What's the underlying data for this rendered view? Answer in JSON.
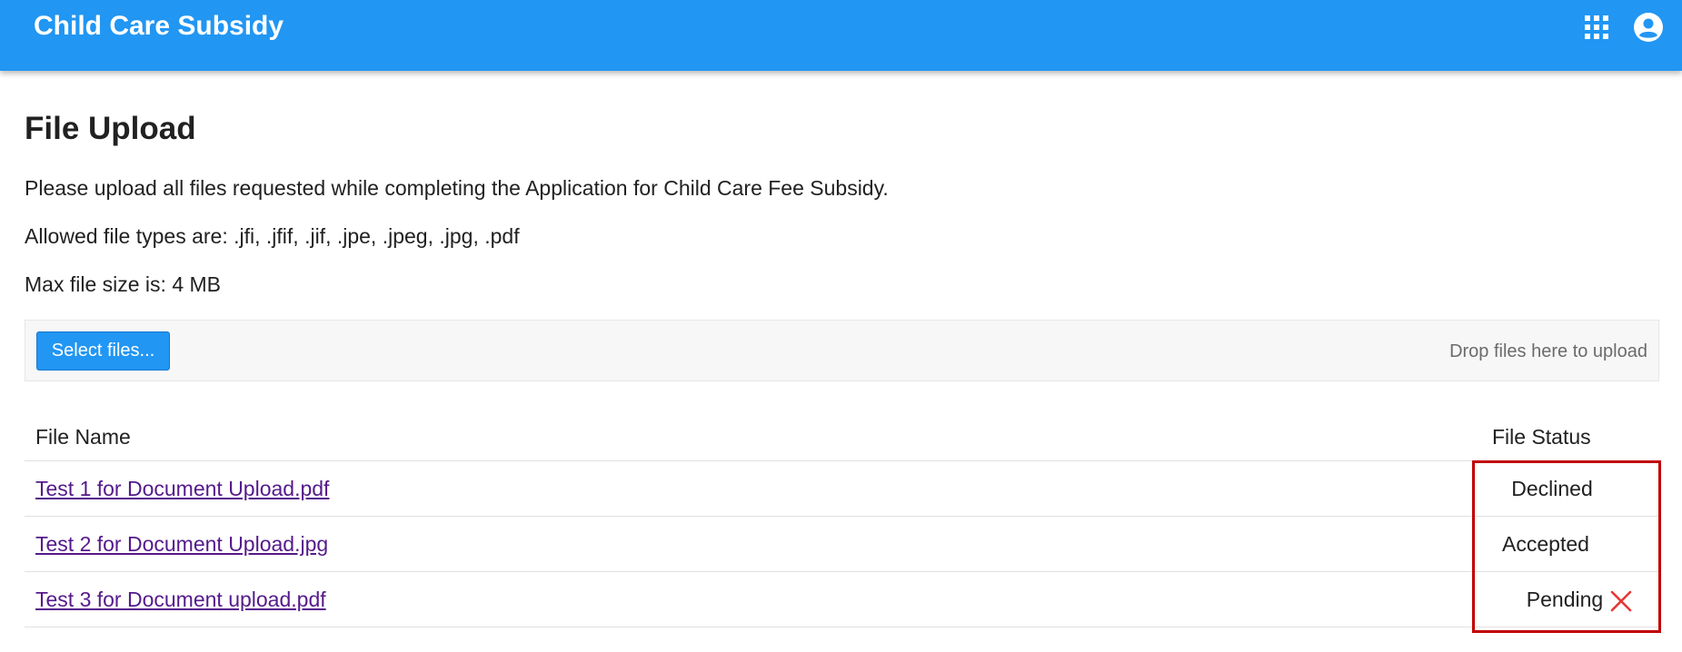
{
  "app": {
    "title": "Child Care Subsidy",
    "brand_color": "#2196f3",
    "icons": [
      "apps-grid-icon",
      "account-circle-icon"
    ]
  },
  "page": {
    "title": "File Upload",
    "instructions": "Please upload all files requested while completing the Application for Child Care Fee Subsidy.",
    "allowed_types": "Allowed file types are: .jfi, .jfif, .jif, .jpe, .jpeg, .jpg, .pdf",
    "max_size": "Max file size is: 4 MB"
  },
  "upload": {
    "select_label": "Select files...",
    "drop_hint": "Drop files here to upload"
  },
  "table": {
    "headers": {
      "file_name": "File Name",
      "file_status": "File Status"
    },
    "rows": [
      {
        "name": "Test 1 for Document Upload.pdf",
        "status": "Declined"
      },
      {
        "name": "Test 2 for Document Upload.jpg",
        "status": "Accepted"
      },
      {
        "name": "Test 3 for Document upload.pdf",
        "status": "Pending",
        "action_icon": "close-icon"
      }
    ]
  },
  "highlight_color": "#c00000",
  "remove_icon_color": "#e53935"
}
